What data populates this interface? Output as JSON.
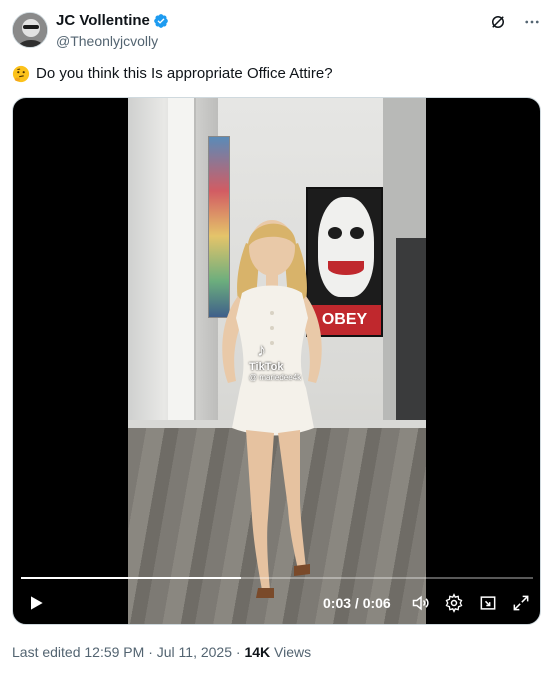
{
  "author": {
    "display_name": "JC Vollentine",
    "handle": "@Theonlyjcvolly",
    "verified": true
  },
  "icons": {
    "verified": "verified-badge-icon",
    "grok": "grok-icon",
    "more": "more-options-icon",
    "emoji": "thinking-face-emoji",
    "play": "play-icon",
    "volume": "volume-icon",
    "settings": "gear-icon",
    "pip": "picture-in-picture-icon",
    "fullscreen": "fullscreen-icon"
  },
  "tweet": {
    "text": "Do you think this Is appropriate Office Attire?"
  },
  "video": {
    "watermark_brand": "TikTok",
    "watermark_user": "@ mariedee4k",
    "poster_text": "OBEY",
    "current_time": "0:03",
    "duration": "0:06",
    "time_display": "0:03 / 0:06",
    "progress_fraction": 0.43
  },
  "meta": {
    "edited_prefix": "Last edited 12:59 PM · Jul 11, 2025 · ",
    "views_count": "14K",
    "views_label": " Views"
  },
  "colors": {
    "accent_blue": "#1d9bf0",
    "text_primary": "#0f1419",
    "text_secondary": "#536471"
  }
}
